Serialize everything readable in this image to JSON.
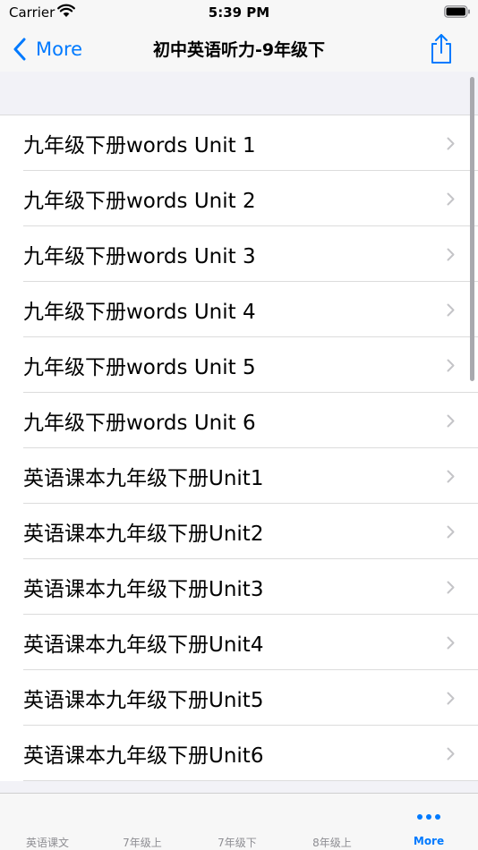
{
  "status_bar": {
    "carrier": "Carrier",
    "time": "5:39 PM"
  },
  "nav": {
    "back_label": "More",
    "title": "初中英语听力-9年级下"
  },
  "list": {
    "items": [
      {
        "label": "九年级下册words Unit 1"
      },
      {
        "label": "九年级下册words Unit 2"
      },
      {
        "label": "九年级下册words Unit 3"
      },
      {
        "label": "九年级下册words Unit 4"
      },
      {
        "label": "九年级下册words Unit 5"
      },
      {
        "label": "九年级下册words Unit 6"
      },
      {
        "label": "英语课本九年级下册Unit1"
      },
      {
        "label": "英语课本九年级下册Unit2"
      },
      {
        "label": "英语课本九年级下册Unit3"
      },
      {
        "label": "英语课本九年级下册Unit4"
      },
      {
        "label": "英语课本九年级下册Unit5"
      },
      {
        "label": "英语课本九年级下册Unit6"
      }
    ]
  },
  "tabs": [
    {
      "label": "英语课文"
    },
    {
      "label": "7年级上"
    },
    {
      "label": "7年级下"
    },
    {
      "label": "8年级上"
    },
    {
      "label": "More",
      "icon": "more-icon",
      "active": true
    }
  ],
  "colors": {
    "accent": "#007aff",
    "inactive": "#8e8e93",
    "background": "#f2f2f7"
  }
}
